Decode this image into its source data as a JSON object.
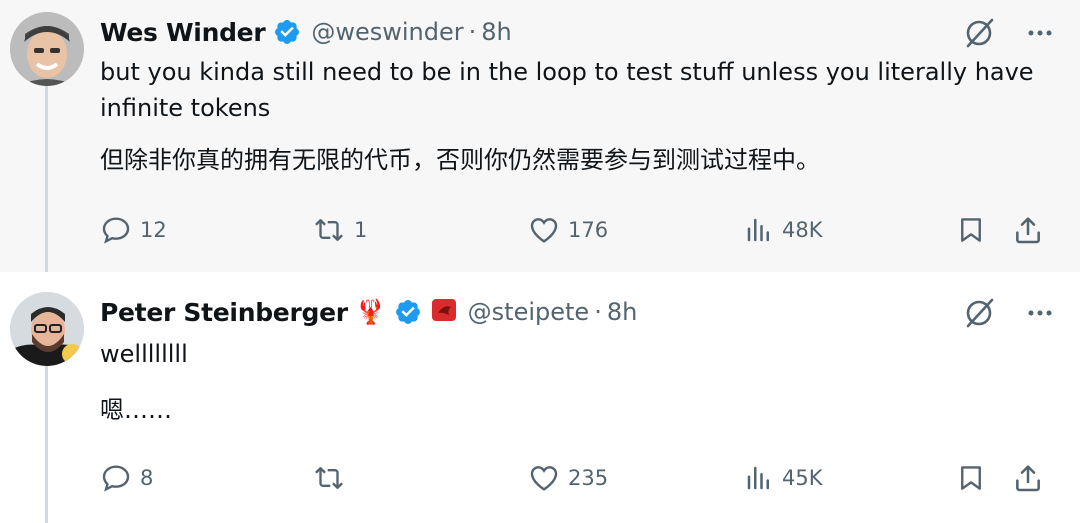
{
  "colors": {
    "verified": "#1d9bf0",
    "muted": "#536471",
    "text": "#0f1419",
    "thread_line": "#cfd9de"
  },
  "tweets": [
    {
      "author_name": "Wes Winder",
      "handle": "@weswinder",
      "separator": "·",
      "time": "8h",
      "text_en": "but you kinda still need to be in the loop to test stuff unless you literally have infinite tokens",
      "text_zh": "但除非你真的拥有无限的代币，否则你仍然需要参与到测试过程中。",
      "replies": "12",
      "retweets": "1",
      "likes": "176",
      "views": "48K"
    },
    {
      "author_name": "Peter Steinberger",
      "name_emoji": "🦞",
      "handle": "@steipete",
      "separator": "·",
      "time": "8h",
      "text_en": "wellllllll",
      "text_zh": "嗯……",
      "replies": "8",
      "retweets": "",
      "likes": "235",
      "views": "45K"
    }
  ],
  "icons": [
    "reply-icon",
    "retweet-icon",
    "like-icon",
    "views-icon",
    "bookmark-icon",
    "share-icon",
    "grok-icon",
    "more-icon",
    "verified-icon"
  ]
}
